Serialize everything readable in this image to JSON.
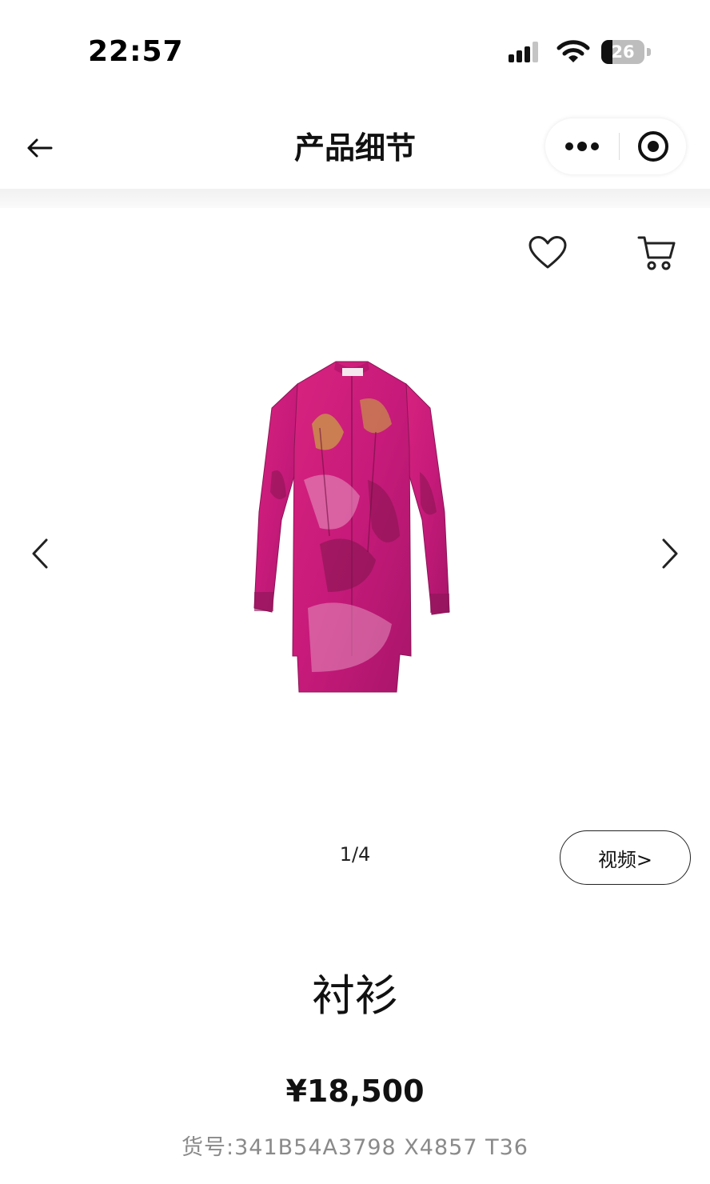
{
  "status_bar": {
    "time": "22:57",
    "battery_level": "26",
    "battery_fraction": 0.26,
    "icons": [
      "signal-icon",
      "wifi-icon",
      "battery-icon"
    ]
  },
  "nav": {
    "title": "产品细节",
    "back_icon": "arrow-left-icon",
    "more_icon": "more-dots-icon",
    "close_icon": "target-circle-icon"
  },
  "product_actions": {
    "favorite_icon": "heart-icon",
    "cart_icon": "cart-icon"
  },
  "gallery": {
    "counter": "1/4",
    "video_label": "视频>",
    "prev_icon": "chevron-left-icon",
    "next_icon": "chevron-right-icon",
    "image_colors": {
      "primary": "#c71a7a",
      "dark": "#7a1448",
      "accent": "#c8b23a"
    }
  },
  "product": {
    "name": "衬衫",
    "price": "¥18,500",
    "sku": "货号:341B54A3798 X4857 T36"
  },
  "colors": {
    "text_primary": "#111111",
    "text_secondary": "#8a8a8a",
    "border": "#222222"
  }
}
